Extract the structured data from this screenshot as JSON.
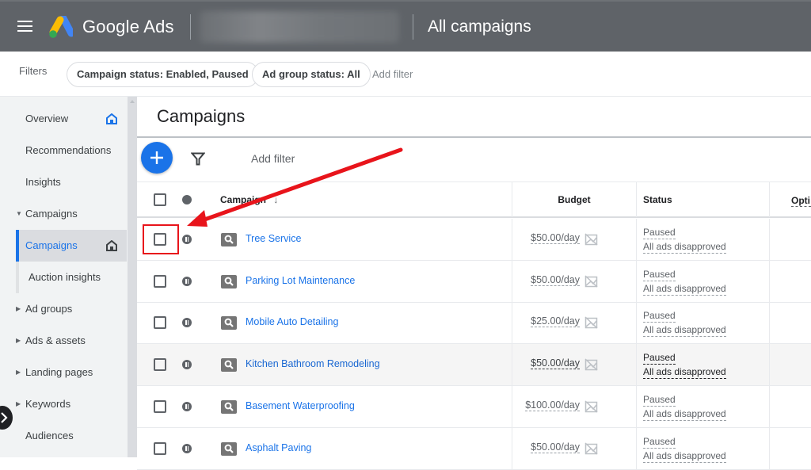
{
  "header": {
    "brand": "Google Ads",
    "account_name_redacted": true,
    "page_scope": "All campaigns"
  },
  "filters": {
    "label": "Filters",
    "chips": [
      "Campaign status: Enabled, Paused",
      "Ad group status: All"
    ],
    "add_filter": "Add filter"
  },
  "sidebar": {
    "items": [
      {
        "label": "Overview",
        "icon": "home-icon",
        "active_icon_color": "#1a73e8"
      },
      {
        "label": "Recommendations"
      },
      {
        "label": "Insights"
      },
      {
        "label": "Campaigns",
        "expanded": true
      },
      {
        "label": "Campaigns",
        "active": true,
        "icon": "home-icon"
      },
      {
        "label": "Auction insights"
      },
      {
        "label": "Ad groups",
        "collapsed": true
      },
      {
        "label": "Ads & assets",
        "collapsed": true
      },
      {
        "label": "Landing pages",
        "collapsed": true
      },
      {
        "label": "Keywords",
        "collapsed": true
      },
      {
        "label": "Audiences"
      }
    ]
  },
  "main": {
    "title": "Campaigns",
    "add_filter": "Add filter",
    "table": {
      "columns": [
        "Campaign",
        "Budget",
        "Status",
        "Optimization score"
      ],
      "visible_partial_column": "Opti",
      "sort": {
        "column": "Campaign",
        "direction": "descending"
      },
      "rows": [
        {
          "campaign": "Tree Service",
          "budget": "$50.00/day",
          "status": "Paused",
          "status_detail": "All ads disapproved",
          "state": "paused",
          "type": "search"
        },
        {
          "campaign": "Parking Lot Maintenance",
          "budget": "$50.00/day",
          "status": "Paused",
          "status_detail": "All ads disapproved",
          "state": "paused",
          "type": "search"
        },
        {
          "campaign": "Mobile Auto Detailing",
          "budget": "$25.00/day",
          "status": "Paused",
          "status_detail": "All ads disapproved",
          "state": "paused",
          "type": "search"
        },
        {
          "campaign": "Kitchen Bathroom Remodeling",
          "budget": "$50.00/day",
          "status": "Paused",
          "status_detail": "All ads disapproved",
          "state": "paused",
          "type": "search",
          "hovered": true
        },
        {
          "campaign": "Basement Waterproofing",
          "budget": "$100.00/day",
          "status": "Paused",
          "status_detail": "All ads disapproved",
          "state": "paused",
          "type": "search"
        },
        {
          "campaign": "Asphalt Paving",
          "budget": "$50.00/day",
          "status": "Paused",
          "status_detail": "All ads disapproved",
          "state": "paused",
          "type": "search"
        }
      ]
    }
  },
  "annotation": {
    "type": "red-arrow-and-box",
    "target": "Tree Service row checkbox",
    "color": "#e8141b"
  },
  "colors": {
    "topbar": "#5f6368",
    "accent": "#1a73e8",
    "sidebar_bg": "#f1f3f4"
  }
}
